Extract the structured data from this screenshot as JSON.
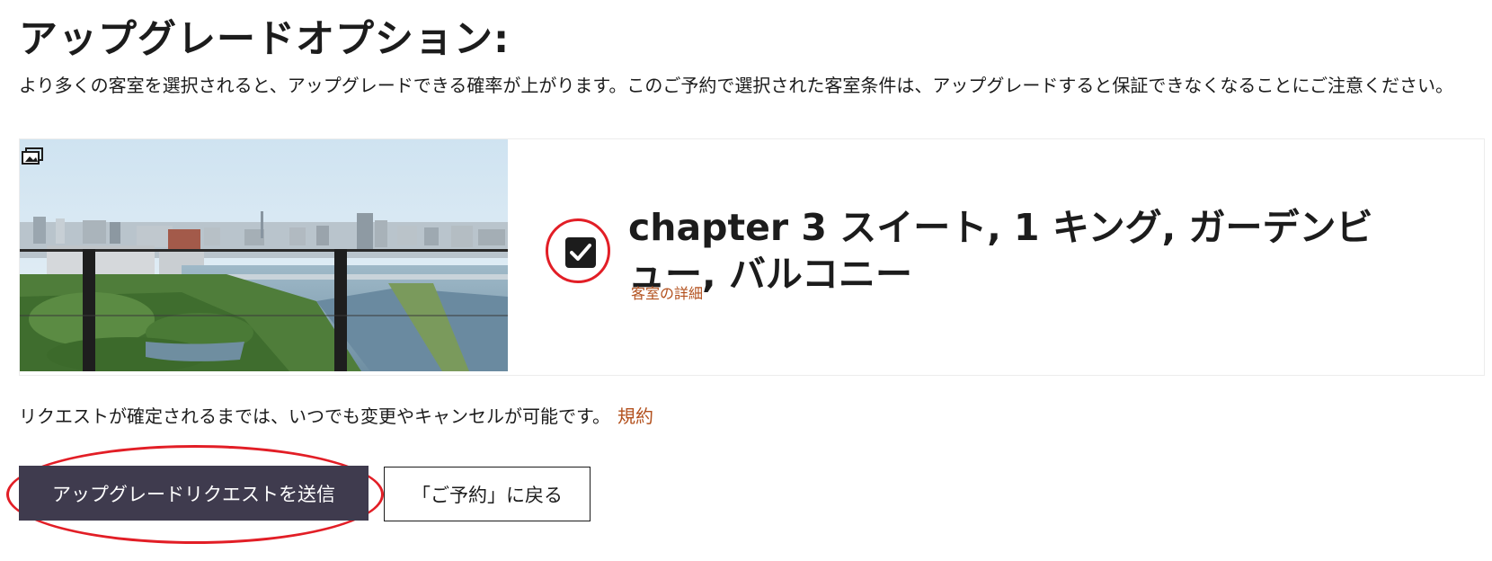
{
  "page": {
    "title": "アップグレードオプション:",
    "intro": "より多くの客室を選択されると、アップグレードできる確率が上がります。このご予約で選択された客室条件は、アップグレードすると保証できなくなることにご注意ください。"
  },
  "room": {
    "name": "chapter 3 スイート, 1 キング, ガーデンビュー, バルコニー",
    "details_link": "客室の詳細",
    "selected": true,
    "photo_icon": "gallery-icon",
    "checkbox_icon": "checkmark-icon"
  },
  "footer": {
    "note": "リクエストが確定されるまでは、いつでも変更やキャンセルが可能です。",
    "terms_link": "規約",
    "submit_label": "アップグレードリクエストを送信",
    "back_label": "「ご予約」に戻る"
  },
  "colors": {
    "accent_link": "#b3511e",
    "primary_button": "#3f3b4e",
    "annotation_red": "#e21e26",
    "text": "#1c1c1c"
  }
}
